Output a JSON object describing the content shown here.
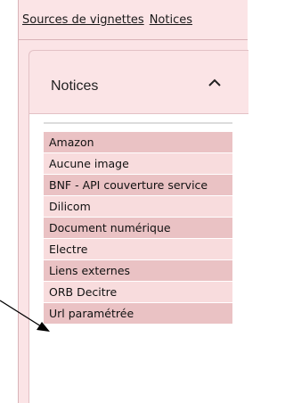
{
  "breadcrumbs": [
    "Sources de vignettes",
    "Notices"
  ],
  "card": {
    "title": "Notices",
    "expanded": true,
    "toggle_icon": "chevron-up-icon"
  },
  "list": {
    "items": [
      "Amazon",
      "Aucune image",
      "BNF - API couverture service",
      "Dilicom",
      "Document numérique",
      "Electre",
      "Liens externes",
      "ORB Decitre",
      "Url paramétrée"
    ]
  },
  "colors": {
    "panel_background": "#fbe4e6",
    "row_dark": "#eac2c4",
    "row_light": "#f8dcdd"
  },
  "annotation": {
    "icon": "arrow-pointer-icon",
    "points_to": "Liens externes"
  }
}
